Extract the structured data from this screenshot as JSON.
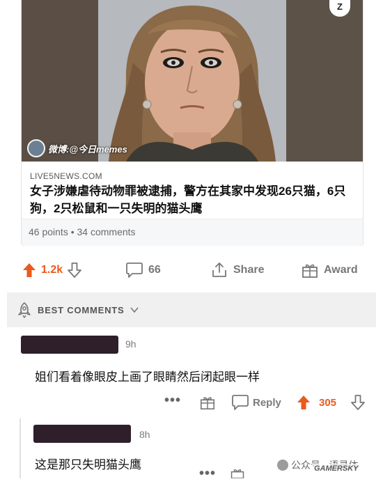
{
  "post": {
    "corner_badge": "Z",
    "watermark_weibo": "微博:@今日memes",
    "domain": "LIVE5NEWS.COM",
    "headline": "女子涉嫌虐待动物罪被逮捕，警方在其家中发现26只猫，6只狗，2只松鼠和一只失明的猫头鹰",
    "meta": "46 points • 34 comments"
  },
  "actions": {
    "upvotes": "1.2k",
    "comments": "66",
    "share": "Share",
    "award": "Award"
  },
  "comments_header": "BEST COMMENTS",
  "comments": [
    {
      "time": "9h",
      "text": "姐们看着像眼皮上画了眼睛然后闭起眼一样",
      "reply": "Reply",
      "score": "305"
    },
    {
      "time": "8h",
      "text": "这是那只失明猫头鹰"
    }
  ],
  "watermark": {
    "text": "公众号 · 语录体",
    "brand": "GAMERSKY"
  },
  "colors": {
    "upvote": "#ea5a1d",
    "muted": "#7b7b7b",
    "header_bg": "#f0f0f1"
  },
  "icons": [
    "upvote-arrow-icon",
    "downvote-arrow-icon",
    "comment-bubble-icon",
    "share-icon",
    "award-gift-icon",
    "best-comments-rocket-icon",
    "chevron-down-icon",
    "more-dots-icon"
  ]
}
